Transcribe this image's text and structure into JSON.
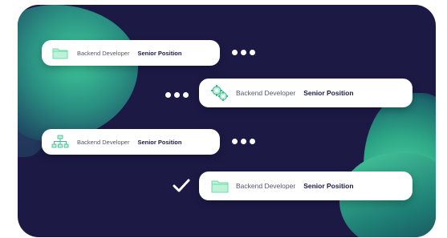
{
  "rows": [
    {
      "title": "Backend Developer",
      "level": "Senior Position",
      "icon": "folder-icon"
    },
    {
      "title": "Backend Developer",
      "level": "Senior Position",
      "icon": "gears-icon"
    },
    {
      "title": "Backend Developer",
      "level": "Senior Position",
      "icon": "org-chart-icon"
    },
    {
      "title": "Backend Developer",
      "level": "Senior Position",
      "icon": "folder-icon"
    }
  ],
  "colors": {
    "background": "#1c1a45",
    "accent": "#7ee3b8",
    "pill": "#ffffff"
  },
  "connector_icons": [
    "dots-icon",
    "dots-icon",
    "dots-icon",
    "checkmark-icon"
  ]
}
